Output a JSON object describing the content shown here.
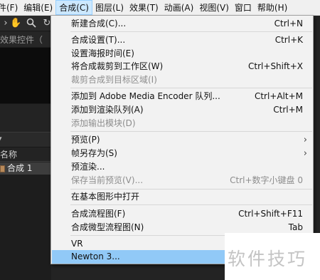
{
  "menubar": {
    "items": [
      {
        "label": "件(F)"
      },
      {
        "label": "编辑(E)"
      },
      {
        "label": "合成(C)"
      },
      {
        "label": "图层(L)"
      },
      {
        "label": "效果(T)"
      },
      {
        "label": "动画(A)"
      },
      {
        "label": "视图(V)"
      },
      {
        "label": "窗口"
      },
      {
        "label": "帮助(H)"
      }
    ],
    "active_index": 2
  },
  "toolbar": {
    "icons": [
      "hand-icon",
      "zoom-icon"
    ]
  },
  "panels": {
    "effects_tab_label": "效果控件（",
    "project_header": "名称",
    "project_row": "合成 1"
  },
  "dropdown": {
    "items": [
      {
        "label": "新建合成(C)...",
        "shortcut": "Ctrl+N"
      },
      {
        "label": "合成设置(T)...",
        "shortcut": "Ctrl+K"
      },
      {
        "label": "设置海报时间(E)",
        "shortcut": ""
      },
      {
        "label": "将合成裁剪到工作区(W)",
        "shortcut": "Ctrl+Shift+X"
      },
      {
        "label": "裁剪合成到目标区域(I)",
        "shortcut": "",
        "disabled": true
      },
      {
        "label": "添加到 Adobe Media Encoder 队列...",
        "shortcut": "Ctrl+Alt+M"
      },
      {
        "label": "添加到渲染队列(A)",
        "shortcut": "Ctrl+M"
      },
      {
        "label": "添加输出模块(D)",
        "shortcut": "",
        "disabled": true
      },
      {
        "label": "预览(P)",
        "shortcut": "",
        "submenu": true
      },
      {
        "label": "帧另存为(S)",
        "shortcut": "",
        "submenu": true
      },
      {
        "label": "预渲染...",
        "shortcut": ""
      },
      {
        "label": "保存当前预览(V)...",
        "shortcut": "Ctrl+数字小键盘 0",
        "disabled": true
      },
      {
        "label": "在基本图形中打开",
        "shortcut": ""
      },
      {
        "label": "合成流程图(F)",
        "shortcut": "Ctrl+Shift+F11"
      },
      {
        "label": "合成微型流程图(N)",
        "shortcut": "Tab"
      },
      {
        "label": "VR",
        "shortcut": "",
        "submenu": true
      },
      {
        "label": "Newton 3...",
        "shortcut": "",
        "highlighted": true
      }
    ],
    "submenu_glyph": "›"
  },
  "watermark": {
    "text": "软件技巧"
  }
}
